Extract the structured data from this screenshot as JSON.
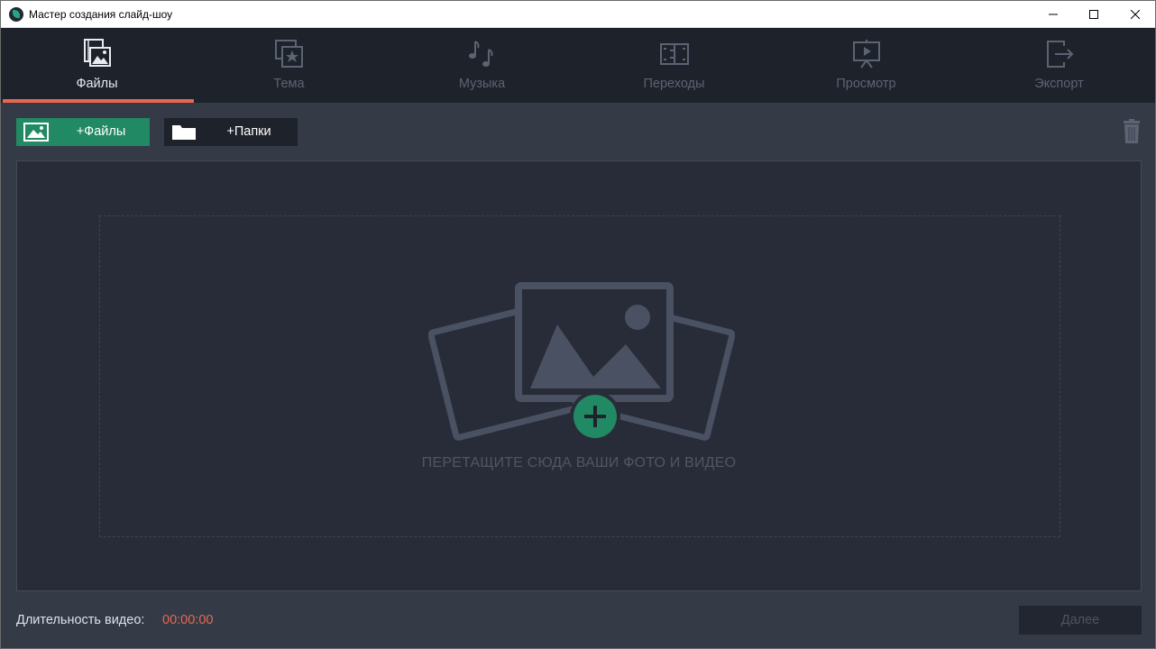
{
  "window": {
    "title": "Мастер создания слайд-шоу"
  },
  "tabs": [
    {
      "label": "Файлы",
      "icon": "film-photo-icon",
      "active": true
    },
    {
      "label": "Тема",
      "icon": "theme-star-icon",
      "active": false
    },
    {
      "label": "Музыка",
      "icon": "music-notes-icon",
      "active": false
    },
    {
      "label": "Переходы",
      "icon": "transitions-icon",
      "active": false
    },
    {
      "label": "Просмотр",
      "icon": "preview-screen-icon",
      "active": false
    },
    {
      "label": "Экспорт",
      "icon": "export-icon",
      "active": false
    }
  ],
  "toolbar": {
    "add_files_label": "+Файлы",
    "add_folders_label": "+Папки"
  },
  "dropzone": {
    "text": "ПЕРЕТАЩИТЕ СЮДА ВАШИ ФОТО И ВИДЕО"
  },
  "footer": {
    "duration_label": "Длительность видео:",
    "duration_value": "00:00:00",
    "next_label": "Далее"
  },
  "colors": {
    "accent": "#e8684f",
    "green": "#218a64",
    "background": "#353a47",
    "tabbar": "#1e222b"
  }
}
